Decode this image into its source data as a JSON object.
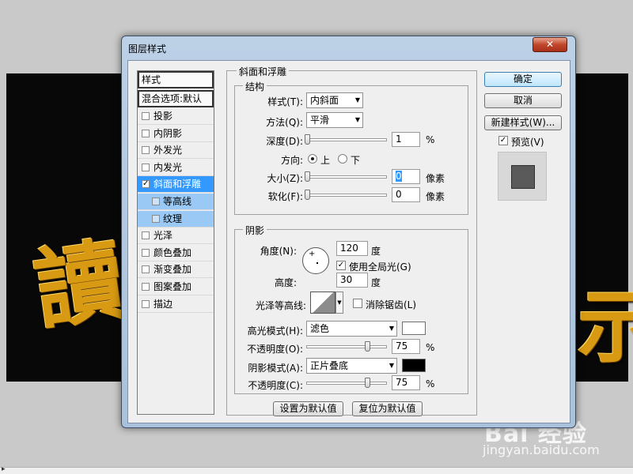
{
  "background": {
    "glyph_left": "讀",
    "glyph_right": "示"
  },
  "dialog": {
    "title": "图层样式",
    "close_symbol": "✕"
  },
  "style_list": {
    "header": "样式",
    "blend_options": "混合选项:默认",
    "items": [
      {
        "label": "投影",
        "checked": false
      },
      {
        "label": "内阴影",
        "checked": false
      },
      {
        "label": "外发光",
        "checked": false
      },
      {
        "label": "内发光",
        "checked": false
      },
      {
        "label": "斜面和浮雕",
        "checked": true,
        "selected": true
      },
      {
        "label": "等高线",
        "checked": false,
        "sub": true
      },
      {
        "label": "纹理",
        "checked": false,
        "sub": true
      },
      {
        "label": "光泽",
        "checked": false
      },
      {
        "label": "颜色叠加",
        "checked": false
      },
      {
        "label": "渐变叠加",
        "checked": false
      },
      {
        "label": "图案叠加",
        "checked": false
      },
      {
        "label": "描边",
        "checked": false
      }
    ]
  },
  "bevel": {
    "section_title": "斜面和浮雕",
    "structure": {
      "title": "结构",
      "style_label": "样式(T):",
      "style_value": "内斜面",
      "technique_label": "方法(Q):",
      "technique_value": "平滑",
      "depth_label": "深度(D):",
      "depth_value": "1",
      "depth_unit": "%",
      "direction_label": "方向:",
      "direction_up": "上",
      "direction_down": "下",
      "size_label": "大小(Z):",
      "size_value": "0",
      "size_unit": "像素",
      "soften_label": "软化(F):",
      "soften_value": "0",
      "soften_unit": "像素"
    },
    "shading": {
      "title": "阴影",
      "angle_label": "角度(N):",
      "angle_value": "120",
      "angle_unit": "度",
      "global_light_label": "使用全局光(G)",
      "global_light_checked": true,
      "altitude_label": "高度:",
      "altitude_value": "30",
      "altitude_unit": "度",
      "gloss_contour_label": "光泽等高线:",
      "anti_alias_label": "消除锯齿(L)",
      "anti_alias_checked": false,
      "highlight_mode_label": "高光模式(H):",
      "highlight_mode_value": "滤色",
      "highlight_color": "#ffffff",
      "highlight_opacity_label": "不透明度(O):",
      "highlight_opacity_value": "75",
      "highlight_opacity_unit": "%",
      "shadow_mode_label": "阴影模式(A):",
      "shadow_mode_value": "正片叠底",
      "shadow_color": "#000000",
      "shadow_opacity_label": "不透明度(C):",
      "shadow_opacity_value": "75",
      "shadow_opacity_unit": "%"
    },
    "make_default": "设置为默认值",
    "reset_default": "复位为默认值"
  },
  "side_buttons": {
    "ok": "确定",
    "cancel": "取消",
    "new_style": "新建样式(W)...",
    "preview_label": "预览(V)",
    "preview_checked": true
  },
  "watermark": {
    "brand": "Bai  经验",
    "url": "jingyan.baidu.com"
  }
}
